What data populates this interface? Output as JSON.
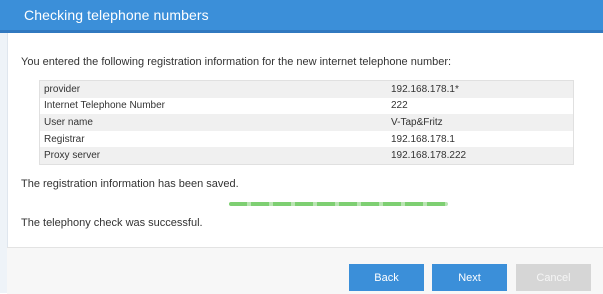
{
  "header": {
    "title": "Checking telephone numbers"
  },
  "intro": "You entered the following registration information for the new internet telephone number:",
  "info_rows": [
    {
      "label": "provider",
      "value": "192.168.178.1*"
    },
    {
      "label": "Internet Telephone Number",
      "value": "222"
    },
    {
      "label": "User name",
      "value": "V-Tap&Fritz"
    },
    {
      "label": "Registrar",
      "value": "192.168.178.1"
    },
    {
      "label": "Proxy server",
      "value": "192.168.178.222"
    }
  ],
  "messages": {
    "saved": "The registration information has been saved.",
    "success": "The telephony check was successful."
  },
  "progress": {
    "value": 100
  },
  "buttons": {
    "back": "Back",
    "next": "Next",
    "cancel": "Cancel"
  },
  "colors": {
    "accent": "#3b8fd9",
    "progress": "#7ecf72",
    "disabled": "#d6d6d6"
  }
}
